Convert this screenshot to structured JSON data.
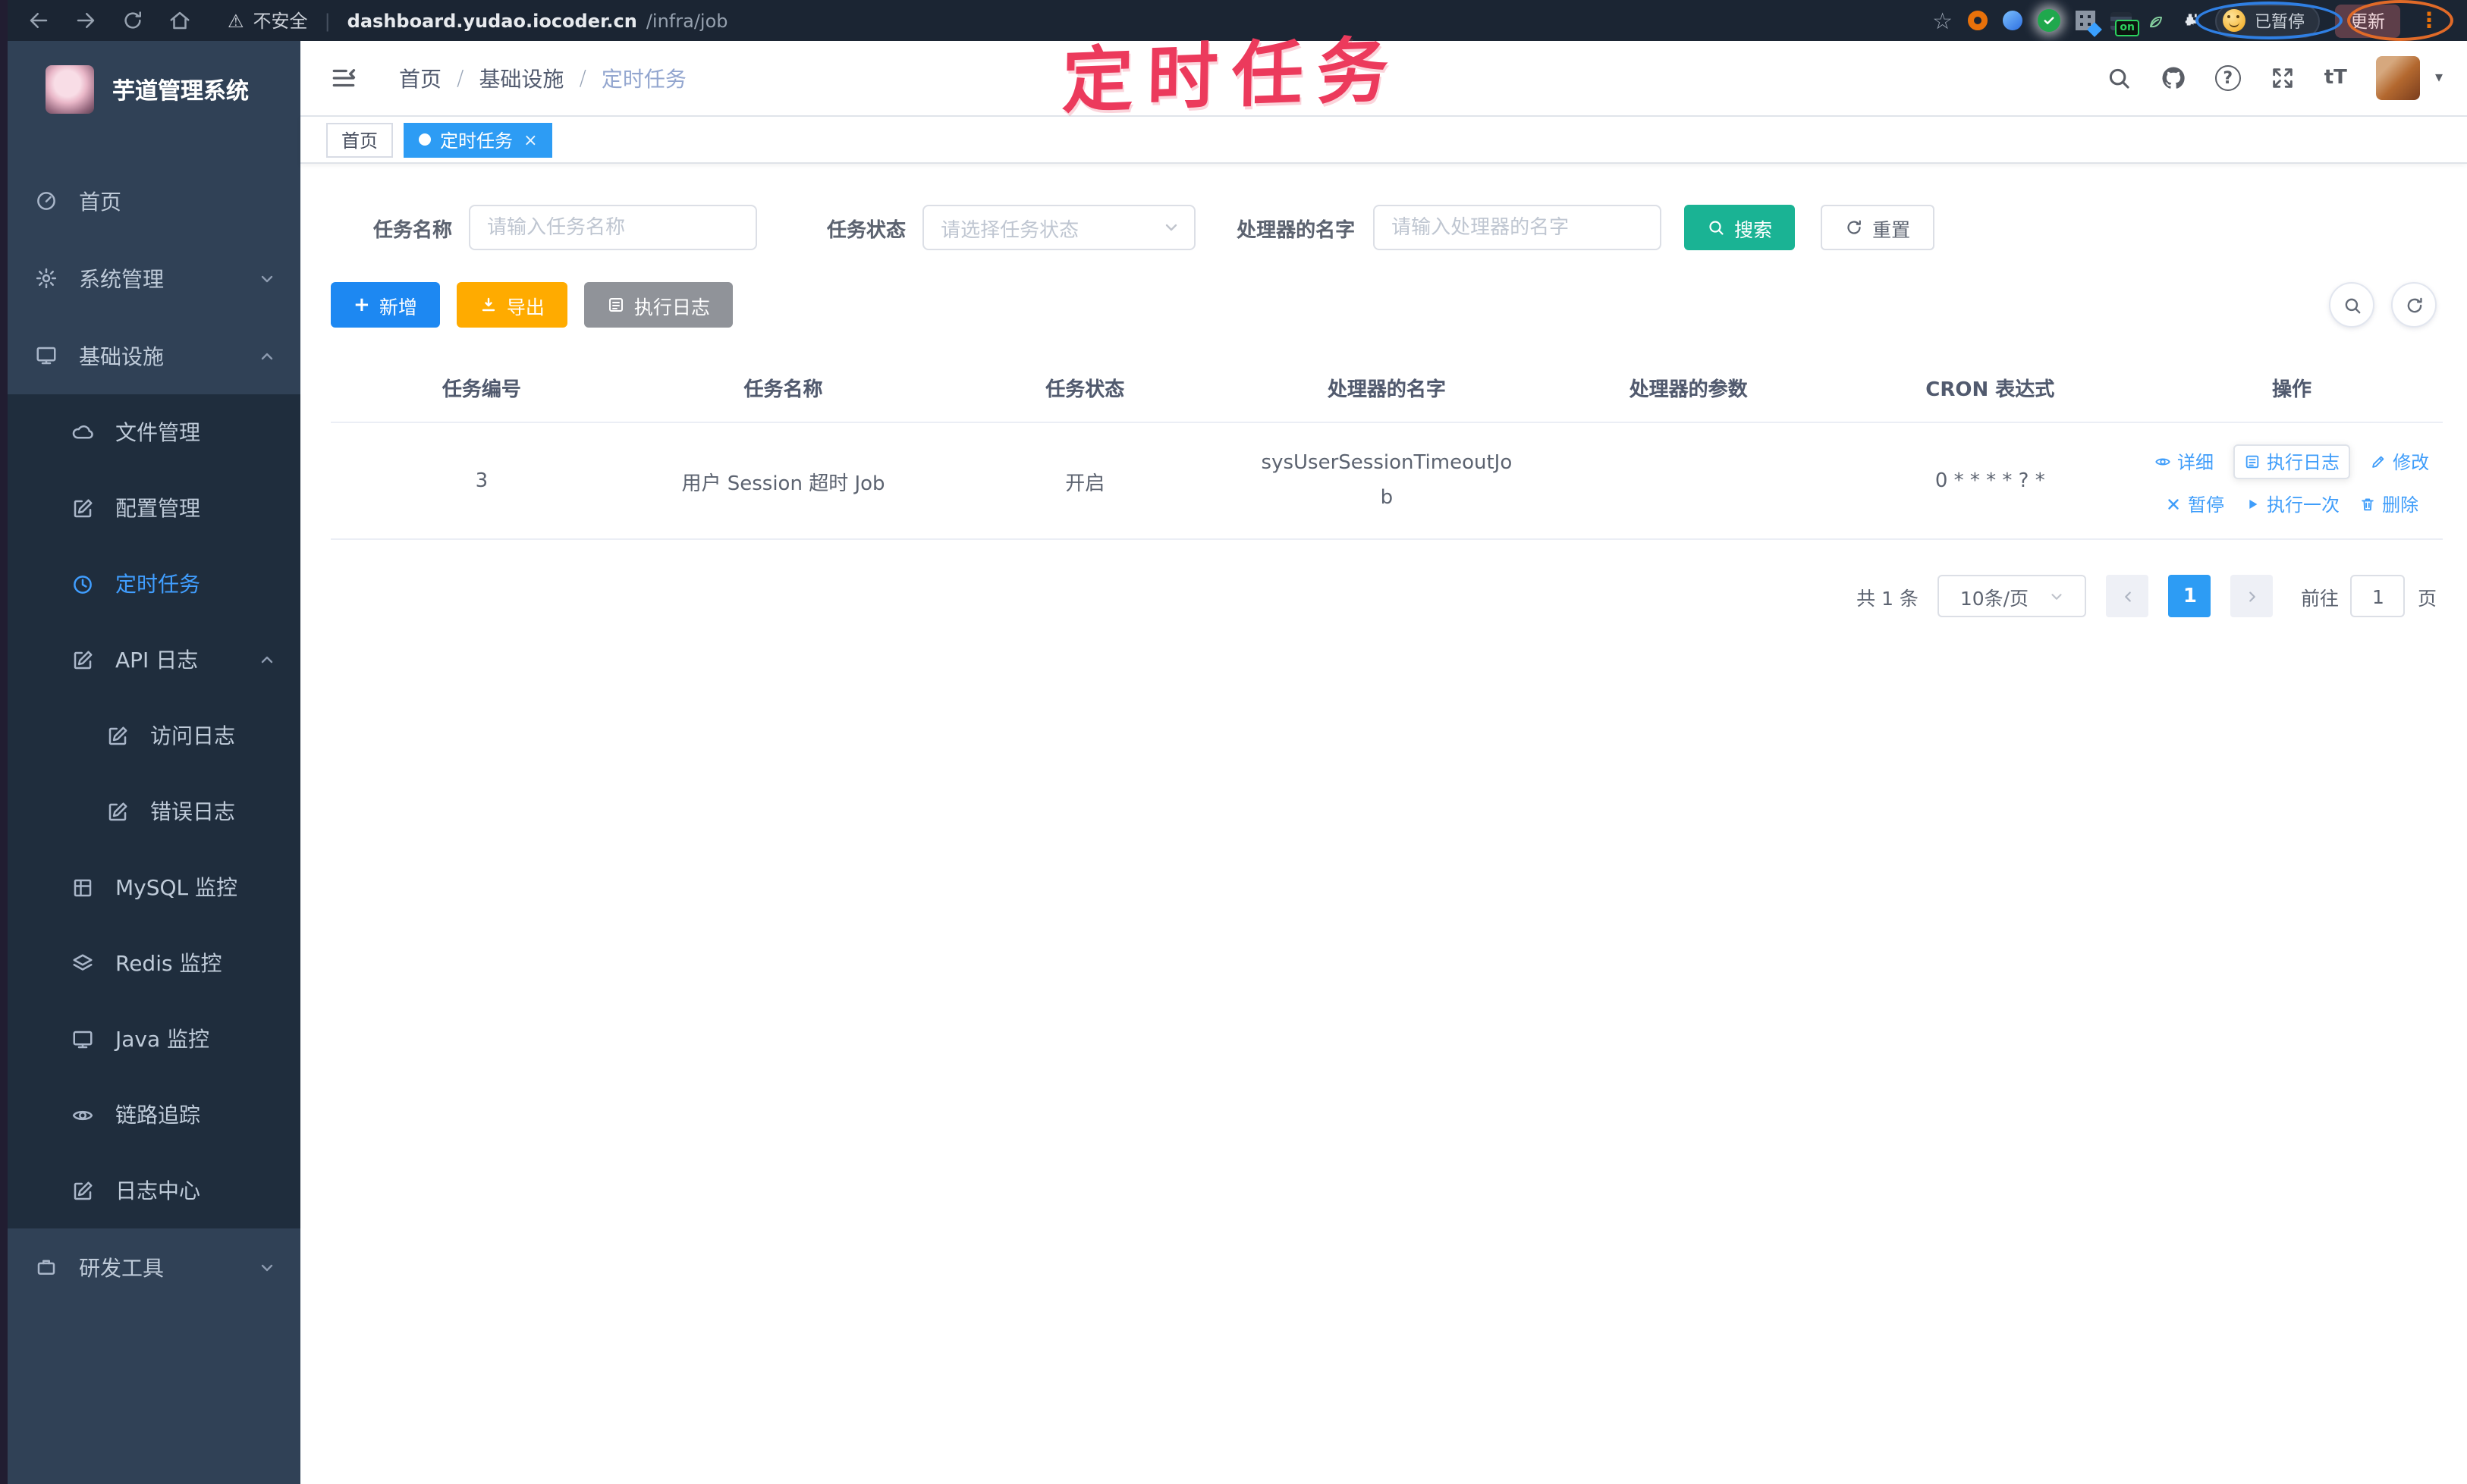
{
  "browser": {
    "security_label": "不安全",
    "url_host": "dashboard.yudao.iocoder.cn",
    "url_path": "/infra/job",
    "paused_badge": "已暂停",
    "update_label": "更新",
    "extension_on_badge": "on"
  },
  "glyphs": {
    "warning": "⚠",
    "divider": "|",
    "star": "☆",
    "kebab": "⋮",
    "question_mark": "?",
    "font_size": "tT",
    "caret_down": "▾",
    "plus": "+",
    "close": "×"
  },
  "annotation": {
    "text": "定时任务"
  },
  "sidebar": {
    "app_title": "芋道管理系统",
    "items": [
      {
        "label": "首页"
      },
      {
        "label": "系统管理"
      },
      {
        "label": "基础设施"
      },
      {
        "label": "文件管理"
      },
      {
        "label": "配置管理"
      },
      {
        "label": "定时任务"
      },
      {
        "label": "API 日志"
      },
      {
        "label": "访问日志"
      },
      {
        "label": "错误日志"
      },
      {
        "label": "MySQL 监控"
      },
      {
        "label": "Redis 监控"
      },
      {
        "label": "Java 监控"
      },
      {
        "label": "链路追踪"
      },
      {
        "label": "日志中心"
      },
      {
        "label": "研发工具"
      }
    ]
  },
  "navbar": {
    "breadcrumb": {
      "home": "首页",
      "section": "基础设施",
      "current": "定时任务"
    }
  },
  "tags": {
    "home": "首页",
    "current": "定时任务"
  },
  "filters": {
    "name_label": "任务名称",
    "name_placeholder": "请输入任务名称",
    "status_label": "任务状态",
    "status_placeholder": "请选择任务状态",
    "handler_label": "处理器的名字",
    "handler_placeholder": "请输入处理器的名字",
    "search_label": "搜索",
    "reset_label": "重置"
  },
  "toolbar": {
    "add_label": "新增",
    "export_label": "导出",
    "exec_log_label": "执行日志"
  },
  "table": {
    "headers": [
      "任务编号",
      "任务名称",
      "任务状态",
      "处理器的名字",
      "处理器的参数",
      "CRON 表达式",
      "操作"
    ],
    "row": {
      "id": "3",
      "name": "用户 Session 超时 Job",
      "status": "开启",
      "handler": "sysUserSessionTimeoutJob",
      "param": "",
      "cron": "0 * * * * ? *",
      "actions": {
        "detail": "详细",
        "log": "执行日志",
        "edit": "修改",
        "pause": "暂停",
        "run": "执行一次",
        "delete": "删除"
      }
    }
  },
  "pagination": {
    "total": "共 1 条",
    "page_size": "10条/页",
    "page": "1",
    "goto_label": "前往",
    "goto_value": "1",
    "page_unit": "页"
  },
  "colors": {
    "accent_blue": "#2d9cf4",
    "link_blue": "#3f9dfa",
    "menu_active_blue": "#409eff",
    "teal": "#1ab394",
    "orange": "#ffab00",
    "info_gray": "#909399",
    "sidebar_bg": "#304156",
    "submenu_bg": "#1f2d3d",
    "chrome_bg": "#1b2533",
    "annotation_red": "#ec3a5c"
  }
}
